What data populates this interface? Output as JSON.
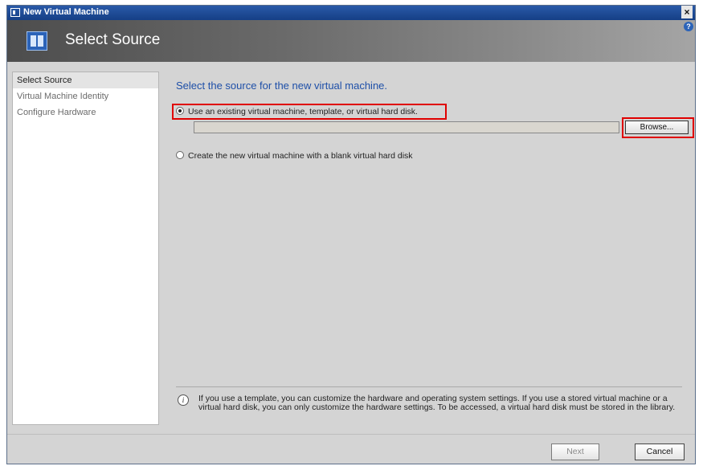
{
  "window": {
    "title": "New Virtual Machine",
    "close_label": "×"
  },
  "header": {
    "title": "Select Source",
    "help_label": "?"
  },
  "sidebar": {
    "items": [
      {
        "label": "Select Source"
      },
      {
        "label": "Virtual Machine Identity"
      },
      {
        "label": "Configure Hardware"
      }
    ]
  },
  "main": {
    "heading": "Select the source for the new virtual machine.",
    "option_existing": {
      "label": "Use an existing virtual machine, template, or virtual hard disk.",
      "selected": true
    },
    "source_path": {
      "value": ""
    },
    "browse_label": "Browse...",
    "option_blank": {
      "label": "Create the new virtual machine with a blank virtual hard disk",
      "selected": false
    },
    "info_text": "If you use a template, you can customize the hardware and operating system settings. If you use a stored virtual machine or a virtual hard disk, you can only customize the hardware settings. To be accessed, a virtual hard disk must be stored in the library."
  },
  "footer": {
    "next_label": "Next",
    "cancel_label": "Cancel"
  },
  "colors": {
    "heading": "#1e4fa8",
    "highlight": "#e00000",
    "titlebar": "#1f4d9a"
  }
}
